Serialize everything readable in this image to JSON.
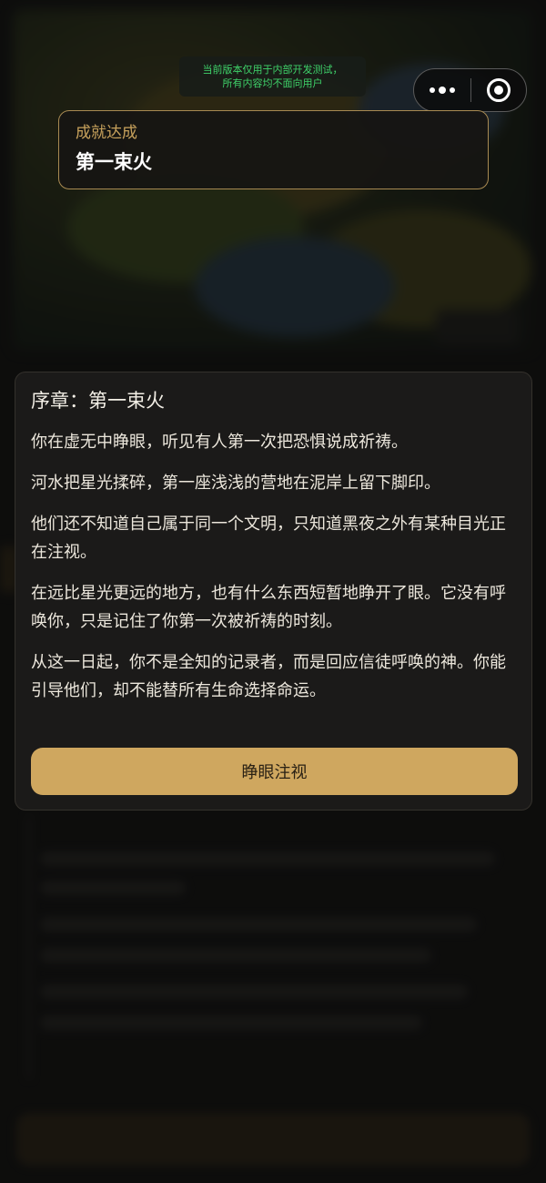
{
  "dev_notice": {
    "line1": "当前版本仅用于内部开发测试，",
    "line2": "所有内容均不面向用户"
  },
  "achievement": {
    "label": "成就达成",
    "title": "第一束火"
  },
  "story": {
    "title": "序章：第一束火",
    "paragraphs": [
      "你在虚无中睁眼，听见有人第一次把恐惧说成祈祷。",
      "河水把星光揉碎，第一座浅浅的营地在泥岸上留下脚印。",
      "他们还不知道自己属于同一个文明，只知道黑夜之外有某种目光正在注视。",
      "在远比星光更远的地方，也有什么东西短暂地睁开了眼。它没有呼唤你，只是记住了你第一次被祈祷的时刻。",
      "从这一日起，你不是全知的记录者，而是回应信徒呼唤的神。你能引导他们，却不能替所有生命选择命运。"
    ],
    "button_label": "睁眼注视"
  },
  "colors": {
    "accent": "#cfa75f",
    "toast_border": "#a88a52",
    "notice_text": "#3fd36a"
  },
  "icons": {
    "more": "more-dots-icon",
    "close": "capsule-close-icon"
  }
}
